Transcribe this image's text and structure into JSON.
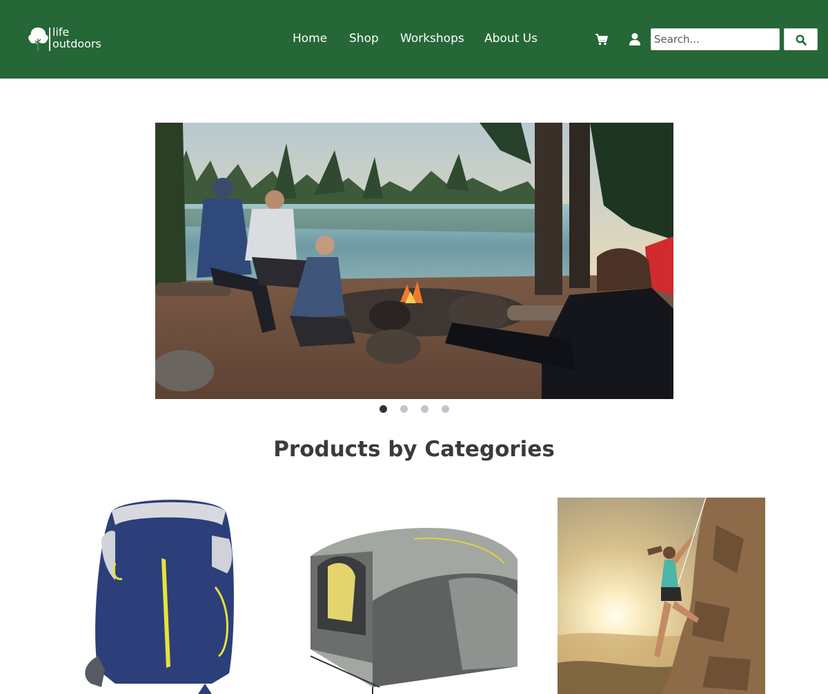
{
  "header": {
    "logo": {
      "line1": "life",
      "line2": "outdoors"
    },
    "nav": [
      {
        "label": "Home"
      },
      {
        "label": "Shop"
      },
      {
        "label": "Workshops"
      },
      {
        "label": "About Us"
      }
    ],
    "search": {
      "placeholder": "Search...",
      "value": ""
    },
    "icons": [
      "cart-icon",
      "user-icon",
      "search-icon"
    ]
  },
  "hero": {
    "slide_count": 4,
    "active_slide": 1
  },
  "categories": {
    "title": "Products by Categories"
  },
  "colors": {
    "brand_green": "#256737",
    "text_dark": "#3b3b3b",
    "dot_active": "#333333",
    "dot_inactive": "#c4c4c4"
  }
}
